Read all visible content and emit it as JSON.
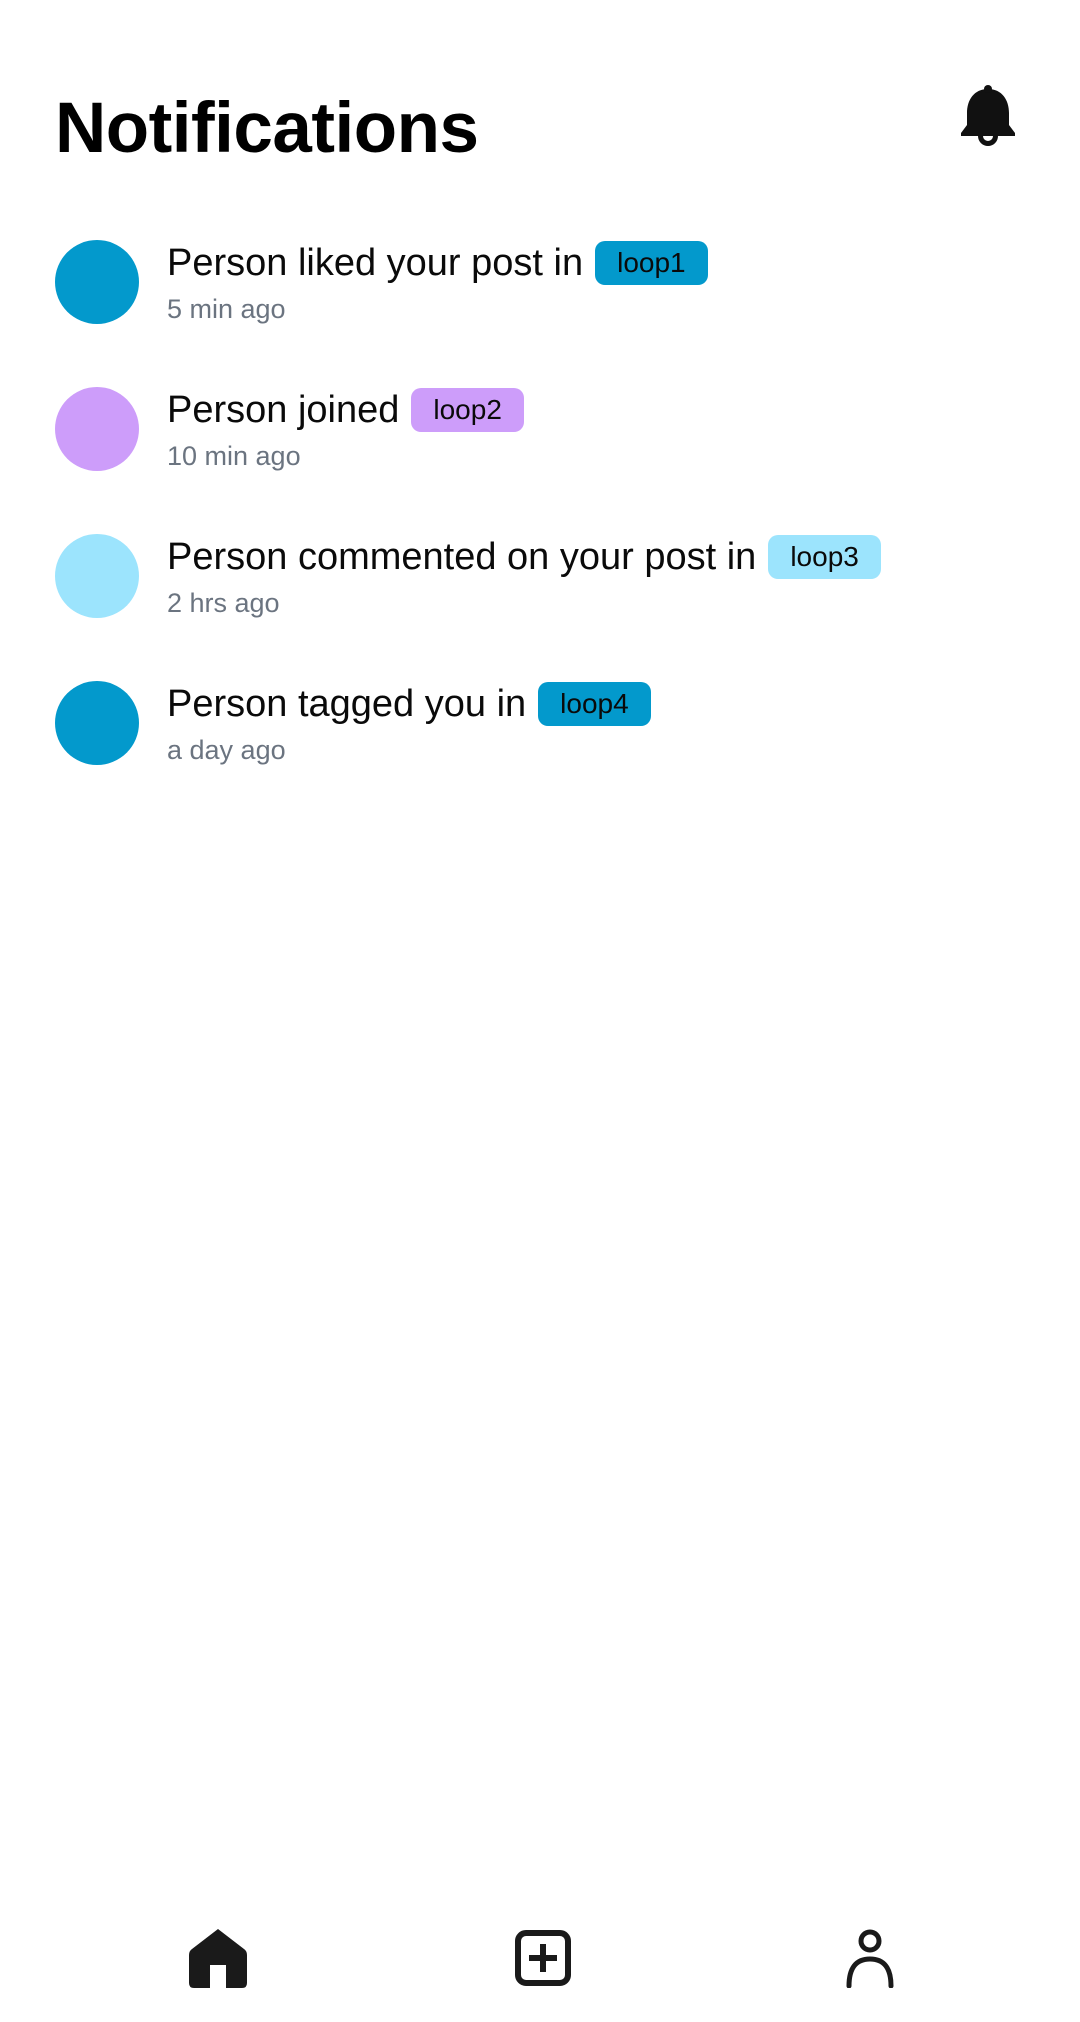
{
  "header": {
    "title": "Notifications",
    "bell_icon": "bell-icon"
  },
  "notifications": [
    {
      "message": "Person liked your post in",
      "tag": "loop1",
      "time": "5 min ago",
      "avatar_color": "#0399cc",
      "tag_color": "#0399cc"
    },
    {
      "message": "Person joined",
      "tag": "loop2",
      "time": "10 min ago",
      "avatar_color": "#cd9dfa",
      "tag_color": "#cd9dfa"
    },
    {
      "message": "Person commented on your post in",
      "tag": "loop3",
      "time": "2 hrs ago",
      "avatar_color": "#9ce4fd",
      "tag_color": "#9ce4fd"
    },
    {
      "message": "Person tagged you in",
      "tag": "loop4",
      "time": "a day ago",
      "avatar_color": "#0399cc",
      "tag_color": "#0399cc"
    }
  ],
  "bottom_nav": {
    "items": [
      {
        "icon": "home-icon"
      },
      {
        "icon": "add-square-icon"
      },
      {
        "icon": "profile-icon"
      }
    ]
  }
}
